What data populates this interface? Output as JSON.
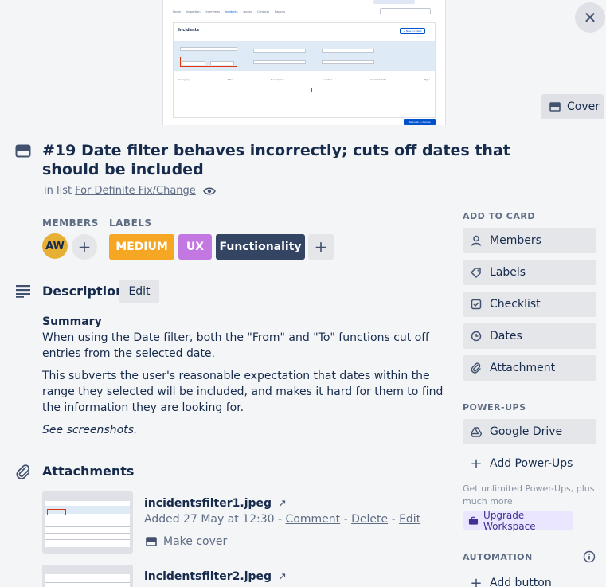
{
  "cover": {
    "screenshot": {
      "nav": [
        "Home",
        "Inspection",
        "Interviews",
        "Incidents",
        "Issues",
        "Contacts",
        "Reports"
      ],
      "panel_title": "Incidents",
      "new_button": "+ New Incident",
      "columns": [
        "Category",
        "Title",
        "Description",
        "Location",
        "Incident date",
        "Type"
      ],
      "footer_button": "Request a change"
    },
    "close_icon": "close-icon",
    "cover_button_label": "Cover"
  },
  "card": {
    "title": "#19 Date filter behaves incorrectly; cuts off dates that should be included",
    "in_list_prefix": "in list",
    "list_name": "For Definite Fix/Change"
  },
  "members": {
    "heading": "MEMBERS",
    "avatar_initials": "AW"
  },
  "labels": {
    "heading": "LABELS",
    "items": [
      {
        "text": "MEDIUM",
        "color": "#f5a623"
      },
      {
        "text": "UX",
        "color": "#c377e0"
      },
      {
        "text": "Functionality",
        "color": "#344563"
      }
    ]
  },
  "description": {
    "heading": "Description",
    "edit_label": "Edit",
    "summary": "Summary",
    "paragraph1": "When using the Date filter, both the \"From\" and \"To\" functions cut off entries from the selected date.",
    "paragraph2": "This subverts the user's reasonable expectation that dates within the range they selected will be included, and makes it hard for them to find the information they are looking for.",
    "paragraph3": "See screenshots."
  },
  "attachments": {
    "heading": "Attachments",
    "items": [
      {
        "name": "incidentsfilter1.jpeg",
        "added": "Added 27 May at 12:30",
        "comment": "Comment",
        "delete": "Delete",
        "edit": "Edit",
        "make_cover": "Make cover"
      },
      {
        "name": "incidentsfilter2.jpeg"
      }
    ],
    "separator": "-"
  },
  "sidebar": {
    "add_to_card": "ADD TO CARD",
    "buttons": [
      "Members",
      "Labels",
      "Checklist",
      "Dates",
      "Attachment"
    ],
    "powerups_heading": "POWER-UPS",
    "google_drive": "Google Drive",
    "add_powerups": "Add Power-Ups",
    "note": "Get unlimited Power-Ups, plus much more.",
    "upgrade": "Upgrade Workspace",
    "automation_heading": "AUTOMATION",
    "add_button": "Add button"
  },
  "colors": {
    "avatar": "#e6b034",
    "upgrade_bg": "#eae6ff",
    "upgrade_text": "#403294"
  }
}
